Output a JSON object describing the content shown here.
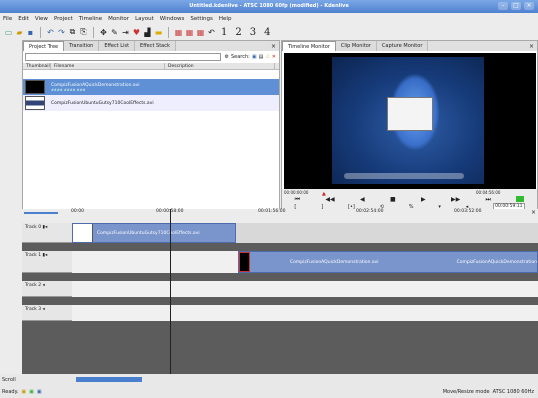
{
  "window": {
    "title": "Untitled.kdenlive - ATSC 1080 60fp (modified) - Kdenlive"
  },
  "menu": [
    "File",
    "Edit",
    "View",
    "Project",
    "Timeline",
    "Monitor",
    "Layout",
    "Windows",
    "Settings",
    "Help"
  ],
  "layouts": [
    "1",
    "2",
    "3",
    "4"
  ],
  "left_tabs": [
    "Project Tree",
    "Transition",
    "Effect List",
    "Effect Stack"
  ],
  "search_label": "Search:",
  "columns": [
    "Thumbnail",
    "Filename",
    "Description"
  ],
  "clips": [
    {
      "name": "CompizFusionAQuickDemonstration.avi",
      "sub": "#### #### ###"
    },
    {
      "name": "CompizFusionUbuntuGutsy710CoolEffects.avi",
      "sub": ""
    }
  ],
  "monitor_tabs": [
    "Timeline Monitor",
    "Clip Monitor",
    "Capture Monitor"
  ],
  "monitor": {
    "start_tc": "00:00:00:00",
    "end_tc": "00:04:56:00",
    "current_tc": "00:00:59:11"
  },
  "ruler": [
    "00:00",
    "00:00:58:00",
    "00:01:56:00",
    "00:02:54:00",
    "00:03:52:00"
  ],
  "tracks": [
    {
      "label": "Track 0",
      "clip": "CompizFusionUbuntuGutsy710CoolEffects.avi"
    },
    {
      "label": "Track 1",
      "clip": "CompizFusionAQuickDemonstration.avi",
      "clip2": "CompizFusionAQuickDemonstration"
    },
    {
      "label": "Track 2"
    },
    {
      "label": "Track 3"
    }
  ],
  "scroll_label": "Scroll",
  "status": {
    "ready": "Ready.",
    "mode": "Move/Resize mode",
    "profile": "ATSC 1080 60Hz"
  },
  "colors": {
    "title_bg": "#5a88d6",
    "selection": "#5f8fd4",
    "clip": "#7a94cc",
    "track_bg": "#5c5c5c"
  }
}
